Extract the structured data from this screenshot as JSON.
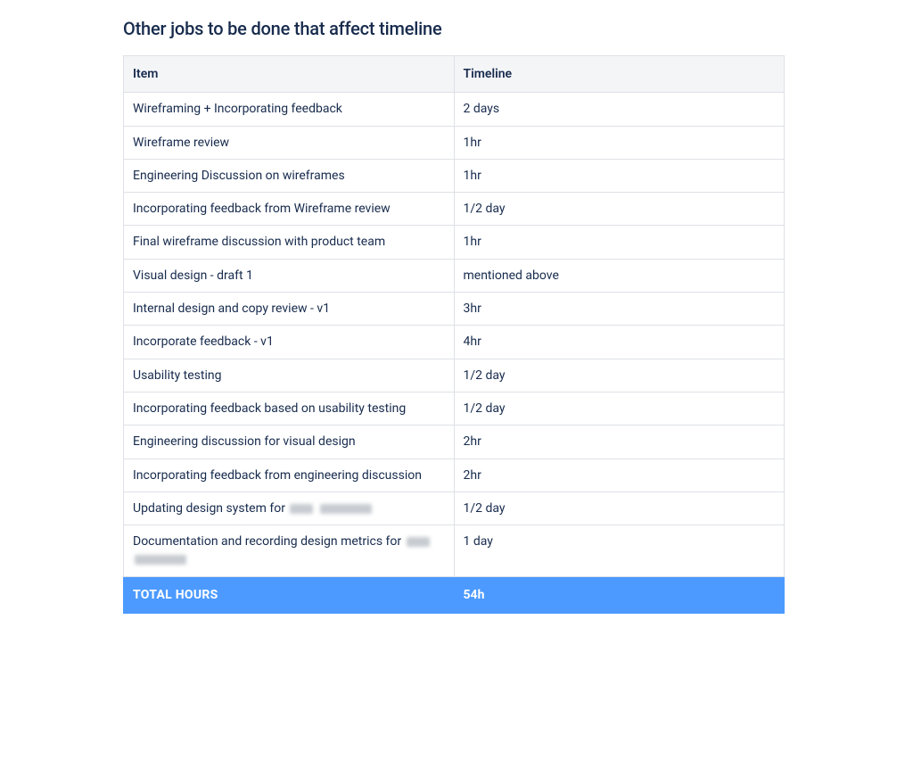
{
  "title": "Other jobs to be done that affect timeline",
  "columns": {
    "item": "Item",
    "timeline": "Timeline"
  },
  "rows": [
    {
      "item": "Wireframing + Incorporating feedback",
      "timeline": "2 days"
    },
    {
      "item": "Wireframe review",
      "timeline": "1hr"
    },
    {
      "item": "Engineering Discussion on wireframes",
      "timeline": "1hr"
    },
    {
      "item": "Incorporating feedback from Wireframe review",
      "timeline": "1/2 day"
    },
    {
      "item": "Final wireframe discussion with product team",
      "timeline": "1hr"
    },
    {
      "item": "Visual design - draft 1",
      "timeline": "mentioned above"
    },
    {
      "item": "Internal design and copy review - v1",
      "timeline": "3hr"
    },
    {
      "item": "Incorporate feedback - v1",
      "timeline": "4hr"
    },
    {
      "item": "Usability testing",
      "timeline": "1/2 day"
    },
    {
      "item": "Incorporating feedback based on usability testing",
      "timeline": "1/2 day"
    },
    {
      "item": "Engineering discussion for visual design",
      "timeline": "2hr"
    },
    {
      "item": "Incorporating feedback from engineering discussion",
      "timeline": "2hr"
    },
    {
      "item_prefix": "Updating design system for ",
      "redacted": true,
      "timeline": "1/2 day"
    },
    {
      "item_prefix": "Documentation and recording design metrics for ",
      "redacted": true,
      "timeline": "1 day"
    }
  ],
  "total": {
    "label": "TOTAL HOURS",
    "value": "54h"
  }
}
